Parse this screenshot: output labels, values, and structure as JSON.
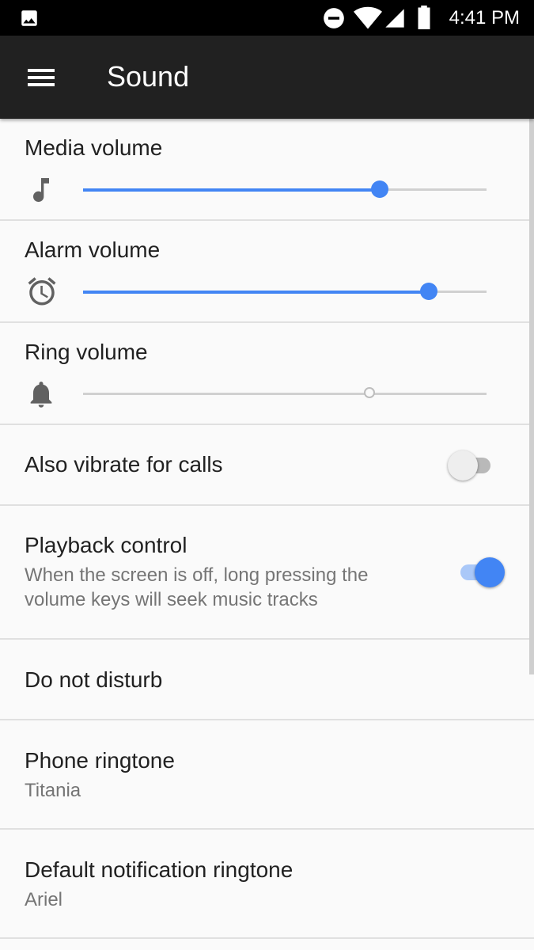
{
  "status_bar": {
    "time": "4:41 PM",
    "icons": [
      "image-icon",
      "do-not-disturb-icon",
      "wifi-icon",
      "cell-signal-icon",
      "battery-icon"
    ]
  },
  "toolbar": {
    "title": "Sound",
    "menu_icon": "menu-icon"
  },
  "colors": {
    "accent": "#4285f4",
    "toolbar": "#212121",
    "status_bar": "#000000",
    "background": "#fafafa"
  },
  "settings": {
    "media_volume": {
      "label": "Media volume",
      "icon": "music-note-icon",
      "level": 0.735
    },
    "alarm_volume": {
      "label": "Alarm volume",
      "icon": "alarm-clock-icon",
      "level": 0.857
    },
    "ring_volume": {
      "label": "Ring volume",
      "icon": "bell-icon",
      "level": 0.71
    },
    "vibrate_for_calls": {
      "label": "Also vibrate for calls",
      "enabled": false
    },
    "playback_control": {
      "label": "Playback control",
      "summary_line1": "When the screen is off, long pressing the",
      "summary_line2": "volume keys will seek music tracks",
      "enabled": true
    },
    "do_not_disturb": {
      "label": "Do not disturb"
    },
    "phone_ringtone": {
      "label": "Phone ringtone",
      "value": "Titania"
    },
    "notification_ringtone": {
      "label": "Default notification ringtone",
      "value": "Ariel"
    }
  }
}
